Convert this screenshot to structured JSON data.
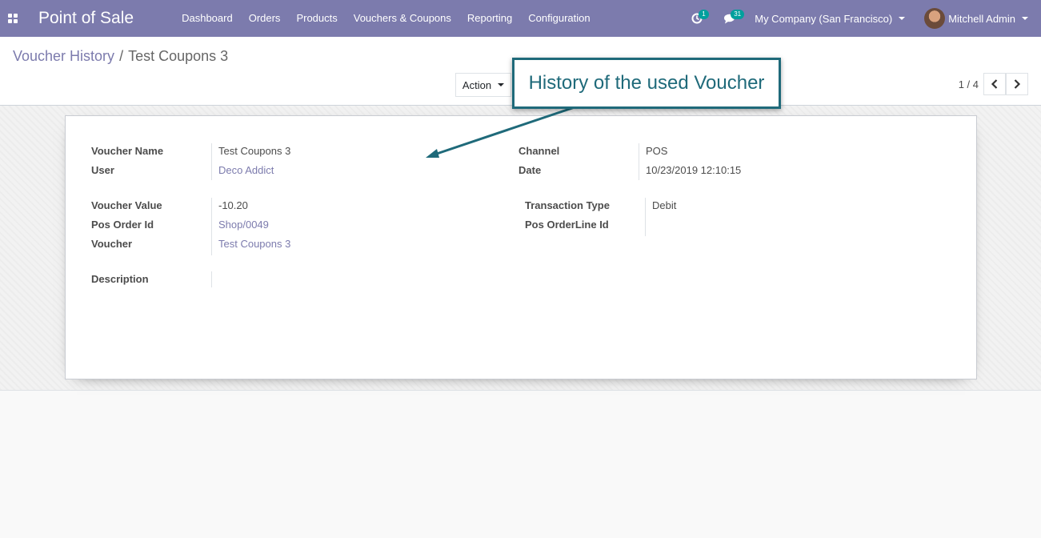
{
  "navbar": {
    "brand": "Point of Sale",
    "menu": [
      "Dashboard",
      "Orders",
      "Products",
      "Vouchers & Coupons",
      "Reporting",
      "Configuration"
    ],
    "activity_badge": "1",
    "messages_badge": "31",
    "company": "My Company (San Francisco)",
    "user": "Mitchell Admin"
  },
  "breadcrumb": {
    "parent": "Voucher History",
    "separator": "/",
    "current": "Test Coupons 3"
  },
  "toolbar": {
    "action_label": "Action"
  },
  "pager": {
    "value": "1 / 4"
  },
  "callout": {
    "text": "History of the used Voucher"
  },
  "form": {
    "voucher_name_label": "Voucher Name",
    "voucher_name": "Test Coupons 3",
    "user_label": "User",
    "user": "Deco Addict",
    "channel_label": "Channel",
    "channel": "POS",
    "date_label": "Date",
    "date": "10/23/2019 12:10:15",
    "voucher_value_label": "Voucher Value",
    "voucher_value": "-10.20",
    "pos_order_id_label": "Pos Order Id",
    "pos_order_id": "Shop/0049",
    "voucher_label": "Voucher",
    "voucher": "Test Coupons 3",
    "transaction_type_label": "Transaction Type",
    "transaction_type": "Debit",
    "pos_orderline_id_label": "Pos OrderLine Id",
    "pos_orderline_id": "",
    "description_label": "Description",
    "description": ""
  },
  "colors": {
    "navbar": "#7c7bad",
    "link": "#7c7bad",
    "callout": "#1f6a7a",
    "badge": "#00a09d"
  }
}
